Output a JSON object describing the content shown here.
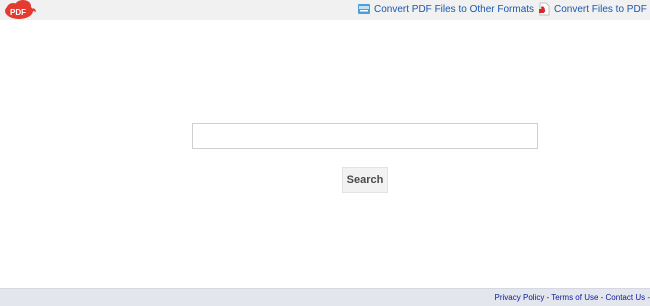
{
  "header": {
    "logo": {
      "text": "PDF",
      "icon": "pdf-logo-icon",
      "color": "#e53a2f"
    },
    "links": [
      {
        "label": "Convert PDF Files to Other Formats",
        "icon": "document-convert-icon"
      },
      {
        "label": "Convert Files to PDF",
        "icon": "pdf-file-icon"
      }
    ]
  },
  "search": {
    "value": "",
    "placeholder": "",
    "button_label": "Search"
  },
  "footer": {
    "links": [
      {
        "label": "Privacy Policy"
      },
      {
        "label": "Terms of Use"
      },
      {
        "label": "Contact Us"
      }
    ],
    "separator": " - ",
    "trailing": " -"
  },
  "colors": {
    "link": "#1a56b0",
    "footer_link": "#0a1a9c",
    "topbar_bg": "#f1f1f1",
    "footer_bg": "#e4e6ee"
  }
}
